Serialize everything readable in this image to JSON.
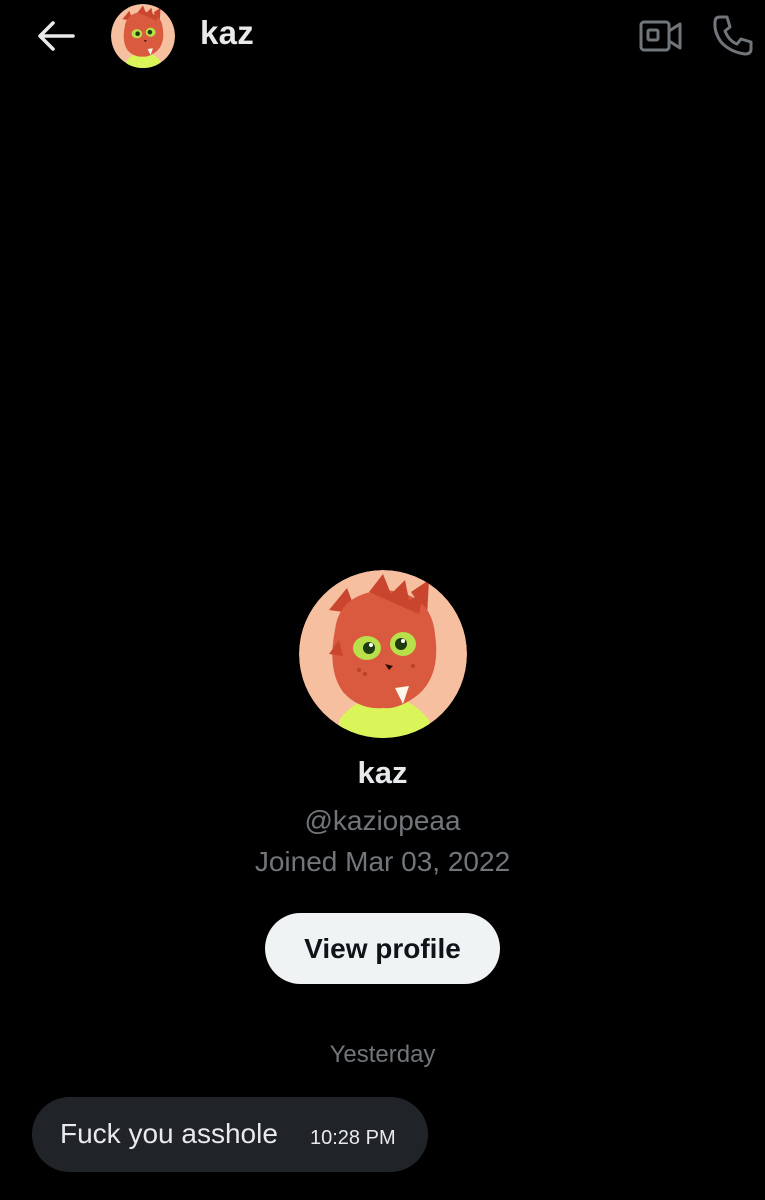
{
  "header": {
    "name": "kaz",
    "back_icon": "arrow-left-icon",
    "video_icon": "video-camera-icon",
    "call_icon": "phone-icon"
  },
  "profile": {
    "name": "kaz",
    "handle": "@kaziopeaa",
    "joined": "Joined Mar 03, 2022",
    "view_profile_label": "View profile"
  },
  "conversation": {
    "day_divider": "Yesterday",
    "messages": [
      {
        "text": "Fuck you asshole",
        "time": "10:28 PM"
      }
    ]
  },
  "colors": {
    "background": "#000000",
    "primary_text": "#e7e9ea",
    "secondary_text": "#71767b",
    "bubble": "#202327",
    "button_bg": "#eff3f4"
  }
}
